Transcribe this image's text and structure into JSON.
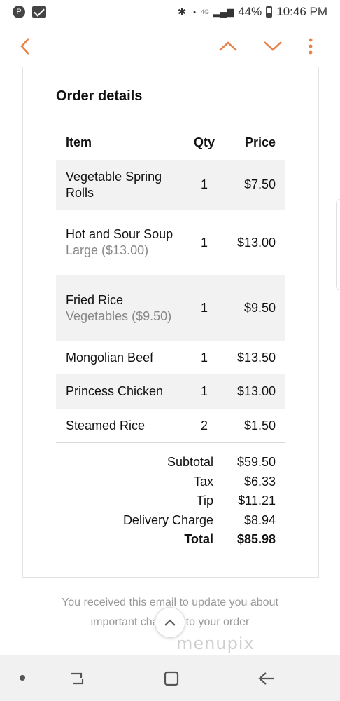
{
  "status_bar": {
    "network": "4G",
    "battery": "44%",
    "time": "10:46 PM"
  },
  "toolbar": {
    "icons": [
      "back-chevron-icon",
      "chevron-up-icon",
      "chevron-down-icon",
      "more-vertical-icon"
    ],
    "accent_color": "#e8804a"
  },
  "order": {
    "title": "Order details",
    "headers": {
      "item": "Item",
      "qty": "Qty",
      "price": "Price"
    },
    "rows": [
      {
        "item": "Vegetable Spring Rolls",
        "detail": "",
        "qty": "1",
        "price": "$7.50"
      },
      {
        "item": "Hot and Sour Soup",
        "detail": "Large ($13.00)",
        "qty": "1",
        "price": "$13.00"
      },
      {
        "item": "Fried Rice",
        "detail": "Vegetables ($9.50)",
        "qty": "1",
        "price": "$9.50"
      },
      {
        "item": "Mongolian Beef",
        "detail": "",
        "qty": "1",
        "price": "$13.50"
      },
      {
        "item": "Princess Chicken",
        "detail": "",
        "qty": "1",
        "price": "$13.00"
      },
      {
        "item": "Steamed Rice",
        "detail": "",
        "qty": "2",
        "price": "$1.50"
      }
    ],
    "totals": [
      {
        "label": "Subtotal",
        "value": "$59.50"
      },
      {
        "label": "Tax",
        "value": "$6.33"
      },
      {
        "label": "Tip",
        "value": "$11.21"
      },
      {
        "label": "Delivery Charge",
        "value": "$8.94"
      },
      {
        "label": "Total",
        "value": "$85.98"
      }
    ]
  },
  "footer": {
    "line1": "You received this email to update you about",
    "line2": "important changes to your order",
    "watermark": "menupix"
  }
}
